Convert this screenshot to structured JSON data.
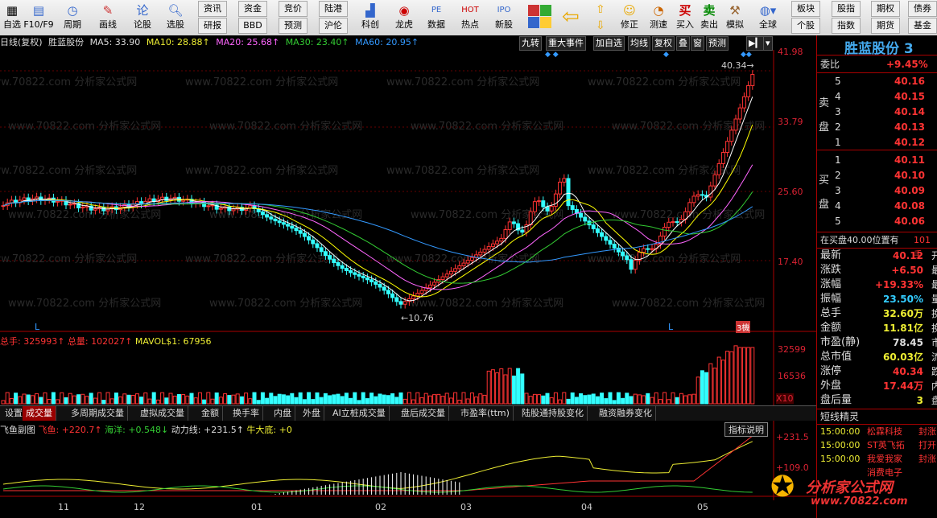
{
  "toolbar": {
    "items": [
      {
        "label": "自选",
        "icon": "grid-icon"
      },
      {
        "label": "F10/F9",
        "icon": "table-icon"
      },
      {
        "label": "周期",
        "icon": "clock-icon"
      },
      {
        "label": "画线",
        "icon": "pencil-icon"
      },
      {
        "label": "论股",
        "icon": "discuss-icon"
      },
      {
        "label": "选股",
        "icon": "magnifier-icon"
      }
    ],
    "text_buttons_top": [
      "资讯",
      "资金",
      "竞价",
      "陆港"
    ],
    "text_buttons_bottom": [
      "研报",
      "BBD",
      "预测",
      "沪伦"
    ],
    "items2": [
      {
        "label": "科创",
        "icon": "chart-icon"
      },
      {
        "label": "龙虎",
        "icon": "dragon-icon"
      },
      {
        "label": "数据",
        "icon": "pe-icon"
      },
      {
        "label": "热点",
        "icon": "hot-icon"
      },
      {
        "label": "新股",
        "icon": "ipo-icon"
      }
    ],
    "items3": [
      {
        "label": "修正",
        "icon": "smile-icon"
      },
      {
        "label": "测速",
        "icon": "stopwatch-icon"
      },
      {
        "label": "买入",
        "icon": "buy-icon"
      },
      {
        "label": "卖出",
        "icon": "sell-icon"
      },
      {
        "label": "模拟",
        "icon": "hammer-icon"
      },
      {
        "label": "全球",
        "icon": "globe-icon"
      }
    ],
    "right_buttons_top": [
      "板块",
      "股指",
      "期权",
      "债券"
    ],
    "right_buttons_bottom": [
      "个股",
      "指数",
      "期货",
      "基金"
    ]
  },
  "title_bar": {
    "period": "日线(复权)",
    "stock": "胜蓝股份",
    "ma5": "MA5: 33.90",
    "ma10": "MA10: 28.88↑",
    "ma20": "MA20: 25.68↑",
    "ma30": "MA30: 23.40↑",
    "ma60": "MA60: 20.95↑"
  },
  "chart_tools": [
    "九转",
    "重大事件",
    "加自选",
    "均线",
    "复权",
    "叠",
    "窗",
    "预测"
  ],
  "price_axis": [
    "41.98",
    "33.79",
    "25.60",
    "17.40"
  ],
  "price_marks": {
    "high": "40.34",
    "low": "10.76"
  },
  "volume_bar": {
    "total": "总手: 325993↑",
    "total2": "总量: 102027↑",
    "mavol": "MAVOL$1: 67956"
  },
  "volume_axis": [
    "32599",
    "16536",
    "X10"
  ],
  "tabs": [
    "设置",
    "成交量",
    "多周期成交量",
    "虚拟成交量",
    "金额",
    "换手率",
    "内盘",
    "外盘",
    "AI立桩成交量",
    "盘后成交量",
    "市盈率(ttm)",
    "陆股通持股变化",
    "融资融券变化"
  ],
  "indicator": {
    "name": "飞鱼副图",
    "fish": "飞鱼: +220.7↑",
    "ocean": "海洋: +0.548↓",
    "power": "动力线: +231.5↑",
    "bull": "牛大底: +0",
    "explain": "指标说明",
    "axis_top": "231.5",
    "axis_mid": "109.0"
  },
  "dates": [
    "11",
    "12",
    "01",
    "02",
    "03",
    "04",
    "05"
  ],
  "quote": {
    "name": "胜蓝股份 3",
    "commission_ratio_label": "委比",
    "commission_ratio": "+9.45%",
    "sell_label": "卖盘",
    "buy_label": "买盘",
    "sells": [
      {
        "n": "5",
        "p": "40.16"
      },
      {
        "n": "4",
        "p": "40.15"
      },
      {
        "n": "3",
        "p": "40.14"
      },
      {
        "n": "2",
        "p": "40.13"
      },
      {
        "n": "1",
        "p": "40.12"
      }
    ],
    "buys": [
      {
        "n": "1",
        "p": "40.11"
      },
      {
        "n": "2",
        "p": "40.10"
      },
      {
        "n": "3",
        "p": "40.09"
      },
      {
        "n": "4",
        "p": "40.08"
      },
      {
        "n": "5",
        "p": "40.06"
      }
    ],
    "note": "在买盘40.00位置有",
    "note_val": "101手",
    "stats": [
      {
        "k": "最新",
        "v": "40.12",
        "x": "开"
      },
      {
        "k": "涨跌",
        "v": "+6.50",
        "x": "最"
      },
      {
        "k": "涨幅",
        "v": "+19.33%",
        "x": "最"
      },
      {
        "k": "振幅",
        "v": "23.50%",
        "x": "量"
      },
      {
        "k": "总手",
        "v": "32.60万",
        "x": "换"
      },
      {
        "k": "金额",
        "v": "11.81亿",
        "x": "换"
      },
      {
        "k": "市盈(静)",
        "v": "78.45",
        "x": "市"
      },
      {
        "k": "总市值",
        "v": "60.03亿",
        "x": "流"
      },
      {
        "k": "涨停",
        "v": "40.34",
        "x": "跌"
      },
      {
        "k": "外盘",
        "v": "17.44万",
        "x": "内"
      },
      {
        "k": "盘后量",
        "v": "3",
        "x": "盘"
      }
    ],
    "short_title": "短线精灵",
    "short_items": [
      {
        "t": "15:00:00",
        "n": "松霖科技",
        "e": "封涨"
      },
      {
        "t": "15:00:00",
        "n": "ST英飞拓",
        "e": "打开"
      },
      {
        "t": "15:00:00",
        "n": "我爱我家",
        "e": "封涨"
      },
      {
        "t": "",
        "n": "消费电子",
        "e": ""
      }
    ]
  },
  "watermark": "www.70822.com 分析家公式网",
  "logo": {
    "cn": "分析家公式网",
    "url": "www.70822.com"
  },
  "colors": {
    "up": "#ff3333",
    "down": "#33ffff",
    "ma5": "#ffffff",
    "ma10": "#ffff00",
    "ma20": "#ff66ff",
    "ma30": "#33cc33",
    "ma60": "#3399ff"
  }
}
